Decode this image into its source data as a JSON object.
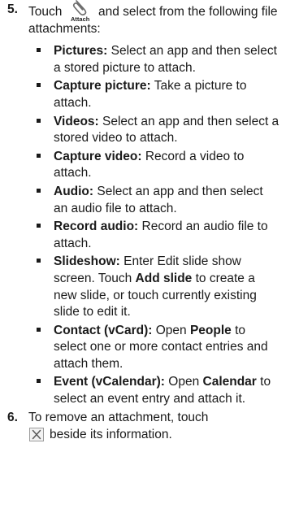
{
  "step5": {
    "number": "5.",
    "text_before_icon": "Touch",
    "icon_label": "Attach",
    "text_after_icon": "and select from the following file attachments:"
  },
  "attachments": [
    {
      "term": "Pictures:",
      "desc": "Select an app and then select a stored picture to attach."
    },
    {
      "term": "Capture picture:",
      "desc": "Take a picture to attach."
    },
    {
      "term": "Videos:",
      "desc": "Select an app and then select a stored video to attach."
    },
    {
      "term": "Capture video:",
      "desc": "Record a video to attach."
    },
    {
      "term": "Audio:",
      "desc": "Select an app and then select an audio file to attach."
    },
    {
      "term": "Record audio:",
      "desc": "Record an audio file to attach."
    },
    {
      "term": "Slideshow:",
      "desc_1": "Enter Edit slide show screen. Touch",
      "bold": "Add slide",
      "desc_2": "to create a new slide, or touch currently existing slide to edit it."
    },
    {
      "term": "Contact (vCard):",
      "desc_1": "Open",
      "bold": "People",
      "desc_2": "to select one or more contact entries and attach them."
    },
    {
      "term": "Event (vCalendar):",
      "desc_1": "Open",
      "bold": "Calendar",
      "desc_2": "to select an event entry and attach it."
    }
  ],
  "step6": {
    "number": "6.",
    "text_before_icon": "To remove an attachment, touch",
    "text_after_icon": "beside its information."
  },
  "icons": {
    "attach": "paperclip-icon",
    "remove": "close-icon"
  }
}
